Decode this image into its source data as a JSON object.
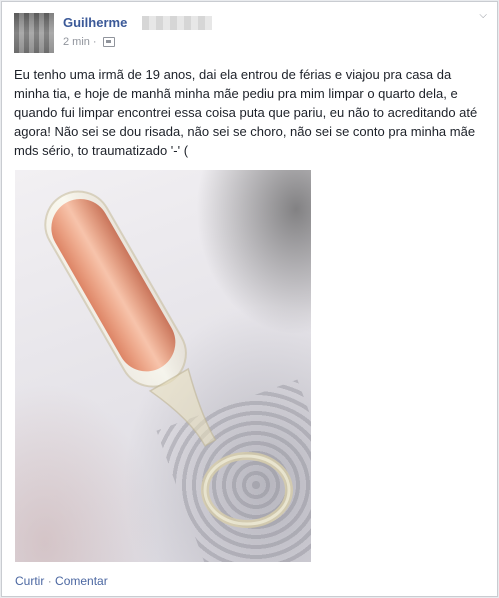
{
  "post": {
    "author": "Guilherme",
    "timestamp": "2 min",
    "separator": "·",
    "audience_icon": "friends-icon",
    "text": "Eu tenho uma irmã de 19 anos, dai ela entrou de férias e viajou pra casa da minha tia, e hoje de manhã minha mãe pediu pra mim limpar o quarto dela, e quando fui limpar encontrei essa coisa puta que pariu, eu não to acreditando até agora! Não sei se dou risada, não sei se choro, não sei se conto pra minha mãe mds sério, to traumatizado '-' ("
  },
  "actions": {
    "like": "Curtir",
    "separator": "·",
    "comment": "Comentar"
  },
  "colors": {
    "author_link": "#3b5998",
    "meta_gray": "#90949c",
    "action_link": "#4b67a1"
  }
}
